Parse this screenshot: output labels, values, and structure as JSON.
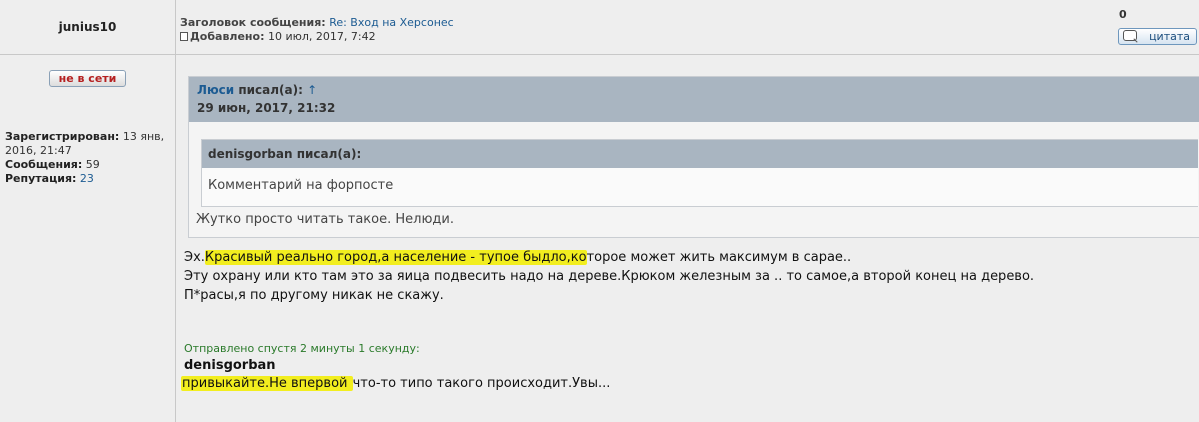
{
  "header": {
    "username": "junius10",
    "subject_label": "Заголовок сообщения:",
    "subject_value": "Re: Вход на Херсонес",
    "added_label": "Добавлено:",
    "added_value": "10 июл, 2017, 7:42",
    "count": "0",
    "quote_button": "цитата"
  },
  "profile": {
    "status": "не в сети",
    "registered_label": "Зарегистрирован:",
    "registered_value": "13 янв, 2016, 21:47",
    "posts_label": "Сообщения:",
    "posts_value": "59",
    "reputation_label": "Репутация:",
    "reputation_value": "23"
  },
  "quote_outer": {
    "author": "Люси",
    "wrote": "писал(а):",
    "arrow": "↑",
    "date": "29 июн, 2017, 21:32",
    "text": "Жутко просто читать такое. Нелюди."
  },
  "quote_inner": {
    "header": "denisgorban писал(а):",
    "text": "Комментарий на форпосте"
  },
  "message": {
    "line1_pre": "Эх.",
    "line1_hl": "Красивый реально город,а население - тупое быдло,ко",
    "line1_post": "торое может жить максимум в сарае..",
    "line2": "Эту охрану или кто там это за яица подвесить надо на дереве.Крюком железным за .. то самое,а второй конец на дерево.",
    "line3": "П*расы,я по другому никак не скажу."
  },
  "followup": {
    "sent_after": "Отправлено спустя 2 минуты 1 секунду:",
    "author": "denisgorban",
    "text_hl": "привыкайте.Не впервой ",
    "text_post": "что-то типо такого происходит.Увы..."
  },
  "colors": {
    "highlight": "#f2ee1f",
    "link": "#1c5b92",
    "quote_header": "#a9b5c1",
    "sent_green": "#2a7a2a"
  }
}
